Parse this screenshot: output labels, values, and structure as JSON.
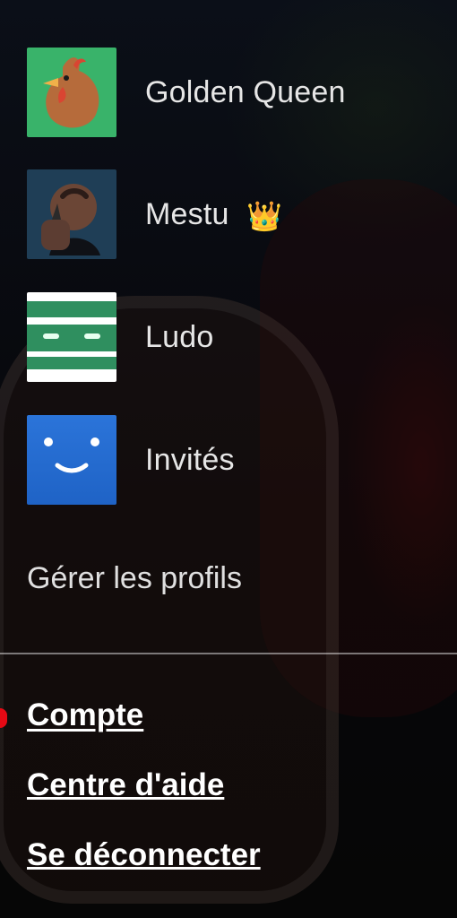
{
  "profiles": [
    {
      "name": "Golden Queen",
      "badge": "",
      "avatar_icon": "hen-avatar-icon"
    },
    {
      "name": "Mestu",
      "badge": "👑",
      "avatar_icon": "man-avatar-icon"
    },
    {
      "name": "Ludo",
      "badge": "",
      "avatar_icon": "mummy-avatar-icon"
    },
    {
      "name": "Invités",
      "badge": "",
      "avatar_icon": "smiley-avatar-icon"
    }
  ],
  "manage_profiles_label": "Gérer les profils",
  "account_links": {
    "account_label": "Compte",
    "help_center_label": "Centre d'aide",
    "sign_out_label": "Se déconnecter"
  },
  "colors": {
    "accent_red": "#e50914",
    "text_primary": "#ffffff",
    "text_secondary": "#e0e0e0"
  }
}
